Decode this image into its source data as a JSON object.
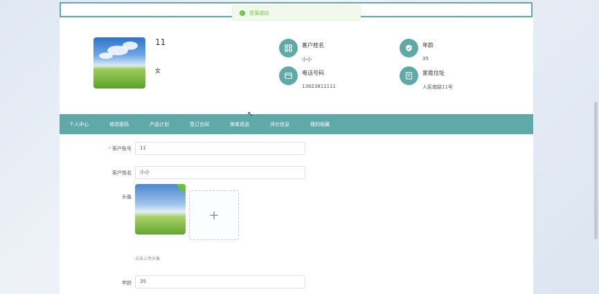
{
  "toast": {
    "message": "登录成功"
  },
  "profile": {
    "name": "11",
    "gender": "女",
    "customer_name_label": "客户姓名",
    "customer_name_value": "小小",
    "age_label": "年龄",
    "age_value": "35",
    "phone_label": "电话号码",
    "phone_value": "13823811111",
    "address_label": "家庭住址",
    "address_value": "人民南路11号"
  },
  "nav": {
    "items": [
      "个人中心",
      "修改密码",
      "产品计划",
      "签订合同",
      "保单退送",
      "评价信息",
      "我的收藏"
    ]
  },
  "form": {
    "account_label": "客户账号",
    "account_value": "11",
    "name_label": "客户姓名",
    "name_value": "小小",
    "avatar_label": "头像",
    "upload_plus": "+",
    "upload_hint": "点击上传头像",
    "age_label": "年龄",
    "age_value": "35"
  }
}
